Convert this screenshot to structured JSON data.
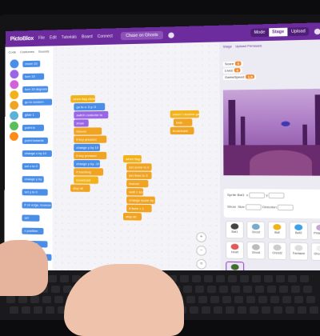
{
  "menubar": {
    "logo": "PictoBlox",
    "items": [
      "File",
      "Edit",
      "Tutorials",
      "Board",
      "Connect"
    ],
    "project_title": "Chase on Ghosts",
    "mode_toggle": {
      "left": "Mode",
      "right_a": "Stage",
      "right_b": "Upload"
    }
  },
  "palette": {
    "tabs": [
      "Code",
      "Costumes",
      "Sounds"
    ],
    "category_colors": [
      "#4b8ee8",
      "#9a66e6",
      "#d061d9",
      "#f2b21c",
      "#f0a421",
      "#5cb1d6",
      "#59c059",
      "#ff8c1a"
    ],
    "blocks": [
      {
        "label": "move 10 steps",
        "color": "#4b8ee8"
      },
      {
        "label": "turn 15 degrees",
        "color": "#4b8ee8"
      },
      {
        "label": "turn 15 degrees",
        "color": "#4b8ee8"
      },
      {
        "label": "go to random position",
        "color": "#4b8ee8"
      },
      {
        "label": "glide 1 secs to",
        "color": "#4b8ee8"
      },
      {
        "label": "point in direction 90",
        "color": "#4b8ee8"
      },
      {
        "label": "point towards",
        "color": "#4b8ee8"
      },
      {
        "label": "change x by 10",
        "color": "#4b8ee8"
      },
      {
        "label": "set x to 0",
        "color": "#4b8ee8"
      },
      {
        "label": "change y by 10",
        "color": "#4b8ee8"
      },
      {
        "label": "set y to 0",
        "color": "#4b8ee8"
      },
      {
        "label": "if on edge, bounce",
        "color": "#4b8ee8"
      },
      {
        "label": "set rotation style",
        "color": "#4b8ee8"
      },
      {
        "label": "x position",
        "color": "#4b8ee8"
      },
      {
        "label": "y position",
        "color": "#4b8ee8"
      },
      {
        "label": "direction",
        "color": "#4b8ee8"
      }
    ]
  },
  "workspace": {
    "scripts": [
      {
        "blocks": [
          {
            "label": "when flag clicked",
            "kind": "evt",
            "w": 30
          },
          {
            "label": "go to x: 0 y: 0",
            "kind": "mot",
            "w": 38
          },
          {
            "label": "switch costume to",
            "kind": "lok",
            "w": 42
          },
          {
            "label": "show",
            "kind": "lok",
            "w": 18
          },
          {
            "label": "forever",
            "kind": "ctl",
            "w": 34
          },
          {
            "label": "if key pressed",
            "kind": "ctl",
            "w": 40
          },
          {
            "label": "change y by 10",
            "kind": "mot",
            "w": 32
          },
          {
            "label": "if key pressed",
            "kind": "ctl",
            "w": 40
          },
          {
            "label": "change y by -10",
            "kind": "mot",
            "w": 32
          },
          {
            "label": "if touching",
            "kind": "ctl",
            "w": 36
          },
          {
            "label": "broadcast",
            "kind": "evt",
            "w": 30
          },
          {
            "label": "stop all",
            "kind": "ctl",
            "w": 24
          }
        ]
      },
      {
        "blocks": [
          {
            "label": "when flag clicked",
            "kind": "evt",
            "w": 22
          },
          {
            "label": "set score to 0",
            "kind": "ctl",
            "w": 30
          },
          {
            "label": "set lives to 3",
            "kind": "ctl",
            "w": 30
          },
          {
            "label": "forever",
            "kind": "ctl",
            "w": 26
          },
          {
            "label": "wait 1 secs",
            "kind": "ctl",
            "w": 20
          },
          {
            "label": "change score by 1",
            "kind": "ctl",
            "w": 34
          },
          {
            "label": "if lives < 1",
            "kind": "ctl",
            "w": 30
          },
          {
            "label": "stop all",
            "kind": "ctl",
            "w": 22
          }
        ]
      },
      {
        "blocks": [
          {
            "label": "when I receive game over",
            "kind": "evt",
            "w": 34
          },
          {
            "label": "hide",
            "kind": "ctl",
            "w": 22
          },
          {
            "label": "broadcast",
            "kind": "ctl",
            "w": 28
          }
        ]
      }
    ],
    "zoom": [
      "+",
      "−",
      "="
    ]
  },
  "stage_panel": {
    "header": [
      "Stage",
      "Upload Firmware"
    ],
    "monitors": [
      {
        "label": "Score",
        "value": "0"
      },
      {
        "label": "Lives",
        "value": "3"
      },
      {
        "label": "GameSpeed",
        "value": "1.5"
      }
    ],
    "sprite_info": {
      "sprite_label": "Sprite",
      "sprite_name": "Bat1",
      "x_label": "x",
      "y_label": "y",
      "show_label": "Show",
      "size_label": "Size",
      "direction_label": "Direction"
    },
    "tiles": [
      {
        "label": "Bat1",
        "color": "#444"
      },
      {
        "label": "Ghost",
        "color": "#7aa9c9"
      },
      {
        "label": "Ball",
        "color": "#f2b21c"
      },
      {
        "label": "Ball2",
        "color": "#3fa0e6"
      },
      {
        "label": "Pixie Ball",
        "color": "#c4a6d0"
      },
      {
        "label": "Heart",
        "color": "#e05a5a"
      },
      {
        "label": "Ghost",
        "color": "#bbb"
      },
      {
        "label": "Ghost2",
        "color": "#ccc"
      },
      {
        "label": "Fantasm",
        "color": "#ddd"
      },
      {
        "label": "GhostCat",
        "color": "#eee"
      },
      {
        "label": "Bat1",
        "color": "#3c6e2c"
      }
    ]
  }
}
